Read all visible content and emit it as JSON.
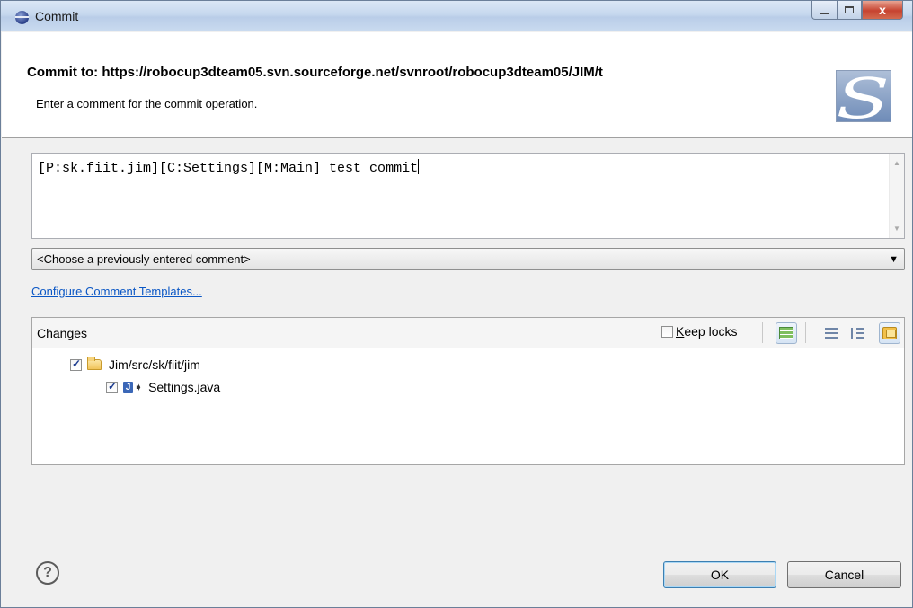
{
  "window": {
    "title": "Commit",
    "close_glyph": "x"
  },
  "header": {
    "heading": "Commit to: https://robocup3dteam05.svn.sourceforge.net/svnroot/robocup3dteam05/JIM/t",
    "subtitle": "Enter a comment for the commit operation."
  },
  "comment": {
    "value": "[P:sk.fiit.jim][C:Settings][M:Main] test commit"
  },
  "previous_comments": {
    "selected": "<Choose a previously entered comment>"
  },
  "templates_link": "Configure Comment Templates...",
  "changes": {
    "title": "Changes",
    "keep_locks_prefix": "K",
    "keep_locks_rest": "eep locks",
    "keep_locks_checked": false,
    "items": [
      {
        "label": "Jim/src/sk/fiit/jim",
        "type": "folder",
        "checked": true
      },
      {
        "label": "Settings.java",
        "type": "java-file",
        "checked": true
      }
    ]
  },
  "footer": {
    "help_glyph": "?",
    "ok_label": "OK",
    "cancel_label": "Cancel"
  }
}
